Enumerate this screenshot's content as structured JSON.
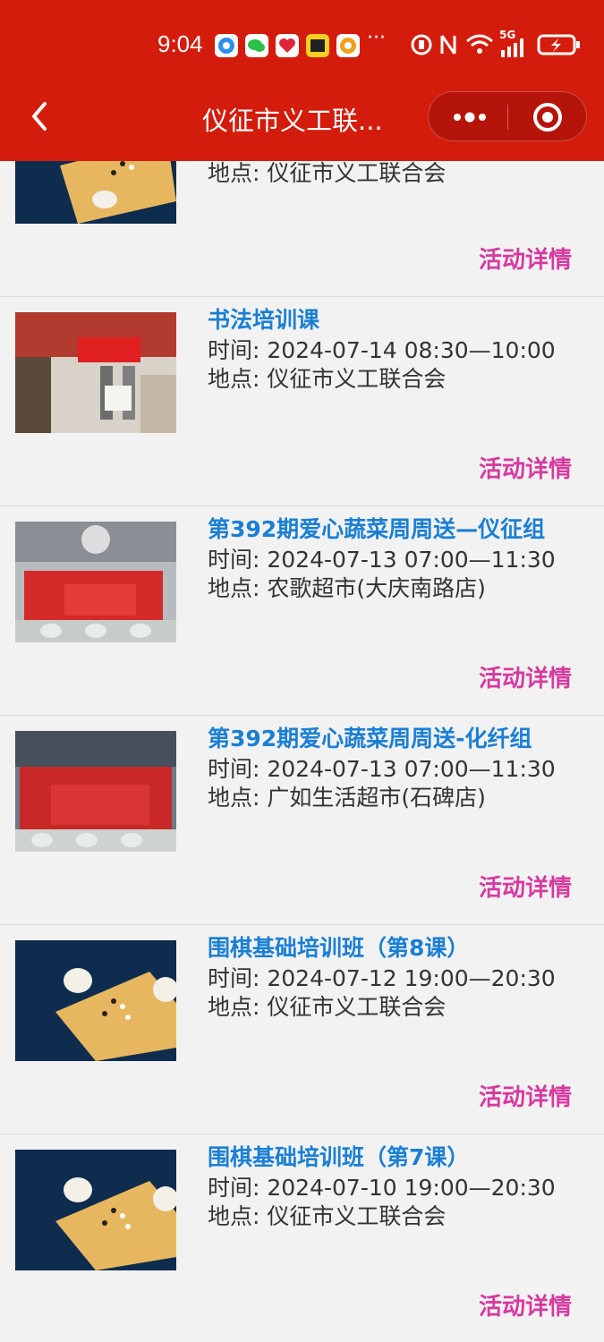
{
  "status_bar": {
    "time": "9:04",
    "more_dots": "···",
    "signal_label": "5G"
  },
  "nav": {
    "title": "仪征市义工联...",
    "back_icon": "chevron-left-icon",
    "more_icon": "more-dots-icon",
    "close_icon": "target-close-icon"
  },
  "activities": [
    {
      "title": "",
      "time": "",
      "place": "地点:  仪征市义工联合会",
      "detail": "活动详情",
      "thumb": "go-board"
    },
    {
      "title": "书法培训课",
      "time": "时间:  2024-07-14 08:30—10:00",
      "place": "地点:  仪征市义工联合会",
      "detail": "活动详情",
      "thumb": "calligraphy"
    },
    {
      "title": "第392期爱心蔬菜周周送—仪征组",
      "time": "时间:  2024-07-13 07:00—11:30",
      "place": "地点:  农歌超市(大庆南路店)",
      "detail": "活动详情",
      "thumb": "volunteers-banner"
    },
    {
      "title": "第392期爱心蔬菜周周送-化纤组",
      "time": "时间:  2024-07-13 07:00—11:30",
      "place": "地点:  广如生活超市(石碑店)",
      "detail": "活动详情",
      "thumb": "volunteers-banner"
    },
    {
      "title": "围棋基础培训班（第8课）",
      "time": "时间:  2024-07-12 19:00—20:30",
      "place": "地点:  仪征市义工联合会",
      "detail": "活动详情",
      "thumb": "go-board"
    },
    {
      "title": "围棋基础培训班（第7课）",
      "time": "时间:  2024-07-10 19:00—20:30",
      "place": "地点:  仪征市义工联合会",
      "detail": "活动详情",
      "thumb": "go-board"
    }
  ],
  "colors": {
    "header_bg": "#d41c0c",
    "title_blue": "#1a7fd4",
    "detail_pink": "#d63aa0"
  }
}
